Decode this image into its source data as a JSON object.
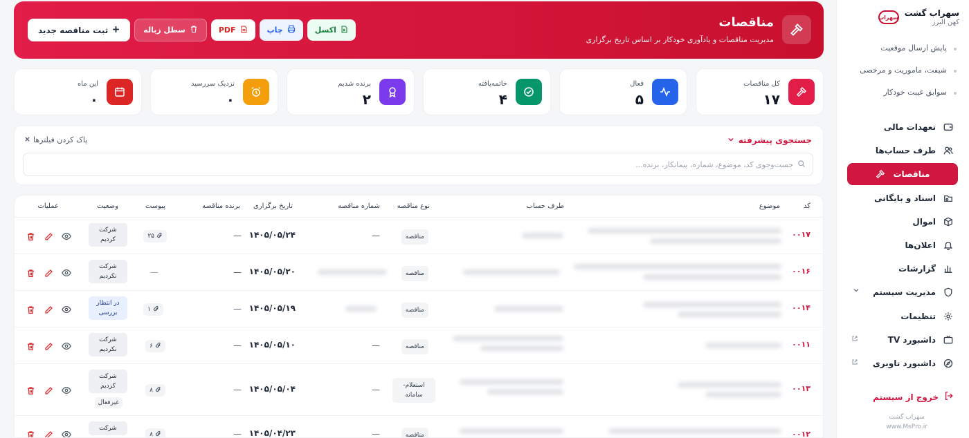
{
  "sidebar": {
    "brand_name": "سهراب گشت",
    "brand_sub": "کهن البرز",
    "logo_text": "سهراب",
    "sub_items": [
      "پایش ارسال موقعیت",
      "شیفت، ماموریت و مرخصی",
      "سوابق غیبت خودکار"
    ],
    "items": [
      {
        "label": "تعهدات مالی",
        "icon": "wallet-icon"
      },
      {
        "label": "طرف حساب‌ها",
        "icon": "users-icon"
      },
      {
        "label": "مناقصات",
        "icon": "gavel-icon",
        "active": true
      },
      {
        "label": "اسناد و بایگانی",
        "icon": "archive-icon"
      },
      {
        "label": "اموال",
        "icon": "box-icon"
      },
      {
        "label": "اعلان‌ها",
        "icon": "bell-icon"
      },
      {
        "label": "گزارشات",
        "icon": "chart-icon"
      },
      {
        "label": "مدیریت سیستم",
        "icon": "shield-icon"
      },
      {
        "label": "تنظیمات",
        "icon": "gear-icon"
      },
      {
        "label": "داشبورد TV",
        "icon": "tv-icon"
      },
      {
        "label": "داشبورد ناوبری",
        "icon": "compass-icon"
      }
    ],
    "logout": "خروج از سیستم",
    "footer_name": "سهراب گشت",
    "footer_url": "www.MsPro.ir"
  },
  "header": {
    "title": "مناقصات",
    "subtitle": "مدیریت مناقصات و یادآوری خودکار بر اساس تاریخ برگزاری",
    "btn_new": "ثبت مناقصه جدید",
    "btn_trash": "سطل زباله",
    "btn_pdf": "PDF",
    "btn_print": "چاپ",
    "btn_excel": "اکسل"
  },
  "colors": {
    "brand": "#d1163f",
    "stat_total": "#e11d48",
    "stat_active": "#2563eb",
    "stat_closed": "#059669",
    "stat_won": "#7c3aed",
    "stat_near": "#f59e0b",
    "stat_month": "#dc2626"
  },
  "stats": [
    {
      "label": "کل مناقصات",
      "value": "۱۷"
    },
    {
      "label": "فعال",
      "value": "۵"
    },
    {
      "label": "خاتمه‌یافته",
      "value": "۴"
    },
    {
      "label": "برنده شدیم",
      "value": "۲"
    },
    {
      "label": "نزدیک سررسید",
      "value": "۰"
    },
    {
      "label": "این ماه",
      "value": "۰"
    }
  ],
  "search": {
    "title": "جستجوی پیشرفته",
    "clear": "پاک کردن فیلترها",
    "placeholder": "جست‌وجوی کد، موضوع، شماره، پیمانکار، برنده..."
  },
  "table": {
    "headers": {
      "code": "کد",
      "subject": "موضوع",
      "party": "طرف حساب",
      "type": "نوع مناقصه",
      "number": "شماره مناقصه",
      "date": "تاریخ برگزاری",
      "winner": "برنده مناقصه",
      "attach": "پیوست",
      "status": "وضعیت",
      "ops": "عملیات"
    },
    "rows": [
      {
        "code": "۰۰۱۷",
        "type": "مناقصه",
        "number": "—",
        "date": "۱۴۰۵/۰۵/۲۴",
        "winner": "—",
        "attach": "۲۵",
        "status": "شرکت کردیم",
        "extra": ""
      },
      {
        "code": "۰۰۱۶",
        "type": "مناقصه",
        "number": "",
        "date": "۱۴۰۵/۰۵/۲۰",
        "winner": "—",
        "attach": "—",
        "status": "شرکت نکردیم",
        "extra": ""
      },
      {
        "code": "۰۰۱۴",
        "type": "مناقصه",
        "number": "",
        "date": "۱۴۰۵/۰۵/۱۹",
        "winner": "—",
        "attach": "۱",
        "status": "در انتظار بررسی",
        "extra": ""
      },
      {
        "code": "۰۰۱۱",
        "type": "مناقصه",
        "number": "—",
        "date": "۱۴۰۵/۰۵/۱۰",
        "winner": "—",
        "attach": "۶",
        "status": "شرکت نکردیم",
        "extra": ""
      },
      {
        "code": "۰۰۱۳",
        "type": "استعلام-سامانه",
        "number": "—",
        "date": "۱۴۰۵/۰۵/۰۴",
        "winner": "—",
        "attach": "۸",
        "status": "شرکت کردیم",
        "extra": "غیرفعال"
      },
      {
        "code": "۰۰۱۲",
        "type": "مناقصه",
        "number": "—",
        "date": "۱۴۰۵/۰۴/۲۳",
        "winner": "—",
        "attach": "۸",
        "status": "شرکت",
        "extra": ""
      }
    ]
  }
}
